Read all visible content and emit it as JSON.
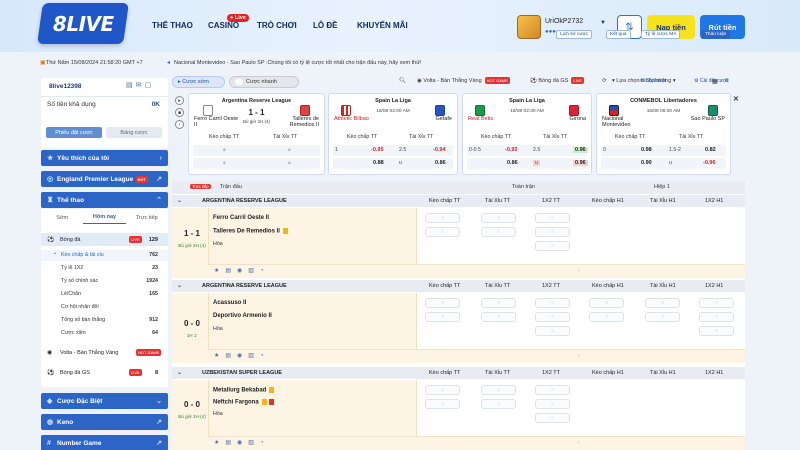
{
  "brand": {
    "logo": "8LIVE"
  },
  "nav": [
    {
      "label": "THỂ THAO"
    },
    {
      "label": "CASINO",
      "badge": "● Live"
    },
    {
      "label": "TRÒ CHƠI"
    },
    {
      "label": "LÔ ĐỀ"
    },
    {
      "label": "KHUYẾN MÃI"
    }
  ],
  "user": {
    "name": "UriOkP2732",
    "deposit": "Nạp tiền",
    "withdraw": "Rút tiền"
  },
  "ticker": {
    "time": "Thứ Năm 15/08/2024 21:58:20 GMT +7",
    "note": "Nacional Montevideo - Sao Paulo SP :Chúng tôi có tỷ lệ cược tốt nhất cho trận đấu này, hãy xem thử!"
  },
  "account": {
    "name": "8live12398",
    "balance_label": "Số tiền khả dụng",
    "balance": "0K",
    "tab1": "Phiếu đặt cược",
    "tab2": "Bảng cược"
  },
  "sidebar": {
    "fav": "Yêu thích của tôi",
    "epl": "England Premier League",
    "epl_badge": "HOT",
    "sports": "Thể thao",
    "tabs": [
      "Sớm",
      "Hôm nay",
      "Trực tiếp"
    ],
    "football": {
      "label": "Bóng đá",
      "badge": "LIVE",
      "count": "129"
    },
    "subs": [
      {
        "label": "Kèo chấp & tài xỉu",
        "count": "762"
      },
      {
        "label": "Tỷ lệ 1X2",
        "count": "23"
      },
      {
        "label": "Tỷ số chính xác",
        "count": "1924"
      },
      {
        "label": "Lẻ/Chẵn",
        "count": "165"
      },
      {
        "label": "Cơ hội nhân đôi",
        "count": ""
      },
      {
        "label": "Tổng số bàn thắng",
        "count": "912"
      },
      {
        "label": "Cược xiên",
        "count": "64"
      }
    ],
    "volta": {
      "label": "Volta - Bàn Thắng Vàng",
      "badge": "HOT GAME"
    },
    "gs": {
      "label": "Bóng đá GS",
      "badge": "LIVE",
      "count": "8"
    },
    "special": "Cược Đặc Biệt",
    "keno": "Keno",
    "number": "Number Game"
  },
  "filters": {
    "a": "Cược sớm",
    "b": "Cược nhanh",
    "volta": "Volta - Bàn Thắng Vàng",
    "volta_badge": "HOT GAME",
    "gs": "Bóng đá GS",
    "gs_badge": "LIVE",
    "sort": "Lựa chọn bình thường",
    "r1": "Lịch sử cược",
    "r2": "Kết quả",
    "r3": "Tỷ lệ cược MA",
    "r4": "Thảo luận",
    "r5": "Cập nhật",
    "r6": "Cài đặt cược"
  },
  "cards": [
    {
      "league": "Argentina Reserve League",
      "teamA": "Ferro Carril Oeste\nII",
      "teamB": "Talleres de\nRemedios II",
      "score": "1 - 1",
      "date": "Bù giờ 2H\n(4)",
      "h1": "Kèo chấp TT",
      "h2": "Tài Xỉu TT",
      "odds": []
    },
    {
      "league": "Spain La Liga",
      "teamA": "Athletic Bilbao",
      "teamB": "Getafe",
      "date": "16/08\n02:00 AM",
      "h1": "Kèo chấp TT",
      "h2": "Tài Xỉu TT",
      "odds": [
        "-0.95",
        "2.5",
        "-0.94",
        "0.88",
        "u",
        "0.86"
      ]
    },
    {
      "league": "Spain La Liga",
      "teamA": "Real Betis",
      "teamB": "Girona",
      "date": "16/08\n02:30 AM",
      "h1": "Kèo chấp TT",
      "h2": "Tài Xỉu TT",
      "odds": [
        "0-0.5",
        "-0.92",
        "2.5",
        "0.96",
        "0.86",
        "u",
        "0.96"
      ]
    },
    {
      "league": "CONMEBOL Libertadores",
      "teamA": "Nacional\nMontevideo",
      "teamB": "Sao Paulo SP",
      "date": "16/08\n05:00 AM",
      "h1": "Kèo chấp TT",
      "h2": "Tài Xỉu TT",
      "odds": [
        "0",
        "0.98",
        "1.5-2",
        "0.82",
        "0.90",
        "u",
        "-0.96"
      ]
    }
  ],
  "table": {
    "live": "Trực tiếp",
    "matches_label": "Trận đấu",
    "full": "Toàn trận",
    "half": "Hiệp 1",
    "cols": [
      "Kèo chấp TT",
      "Tài Xỉu TT",
      "1X2 TT",
      "Kèo chấp H1",
      "Tài Xỉu H1",
      "1X2 H1"
    ],
    "leagues": [
      {
        "name": "ARGENTINA RESERVE LEAGUE",
        "teamA": "Ferro Carril Oeste II",
        "teamB": "Talleres De Remedios II",
        "score": "1 - 1",
        "mins": "Bù giờ 2H\n(4)",
        "draw": "Hòa"
      },
      {
        "name": "ARGENTINA RESERVE LEAGUE",
        "teamA": "Acassuso II",
        "teamB": "Deportivo Armenio II",
        "score": "0 - 0",
        "mins": "1H 1'",
        "draw": "Hòa"
      },
      {
        "name": "UZBEKISTAN SUPER LEAGUE",
        "teamA": "Metallurg Bekabad",
        "teamB": "Neftchi Fargona",
        "score": "0 - 0",
        "mins": "Bù giờ 2H\n(4)",
        "draw": "Hòa"
      }
    ]
  },
  "colors": {
    "primary": "#2d65c6",
    "accent": "#f6e21d",
    "live": "#e53333",
    "match_bg": "#fdf4e4"
  }
}
